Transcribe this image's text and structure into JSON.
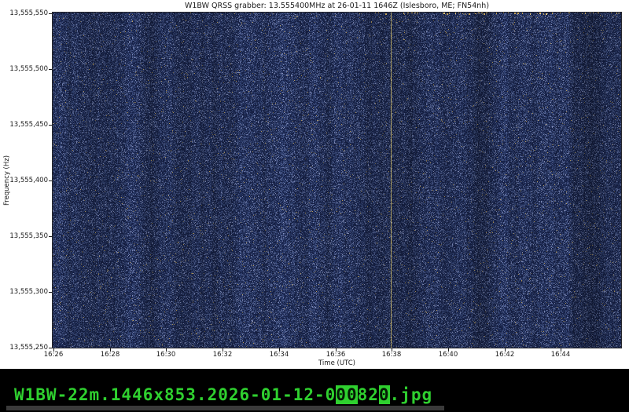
{
  "chart_data": {
    "type": "heatmap",
    "title": "W1BW QRSS grabber: 13.555400MHz at 26-01-11 1646Z (Islesboro, ME; FN54nh)",
    "xlabel": "Time (UTC)",
    "ylabel": "Frequency (Hz)",
    "x_ticks": [
      "16:26",
      "16:28",
      "16:30",
      "16:32",
      "16:34",
      "16:36",
      "16:38",
      "16:40",
      "16:42",
      "16:44"
    ],
    "x_range": [
      "16:26",
      "16:46"
    ],
    "y_ticks": [
      "13,555,550",
      "13,555,500",
      "13,555,450",
      "13,555,400",
      "13,555,350",
      "13,555,300",
      "13,555,250"
    ],
    "y_range_hz": [
      13555250,
      13555550
    ],
    "grid": false,
    "legend": false,
    "description": "QRSS grabber waterfall spectrogram: dark blue RF noise field with faint vertical striation bands, a thin tan vertical line at 16:38 spanning all frequencies, and intermittent tan signal dots along the top edge near 13,555,550 Hz (mostly after ~16:38).",
    "features": {
      "noise_palette": [
        "#141d3e",
        "#1e2a50",
        "#2b3a63",
        "#3d4a74",
        "#55628c",
        "#707aa0",
        "#6a604a",
        "#a48c54"
      ],
      "vertical_line_time": "16:38",
      "vertical_line_color": "#b3a468",
      "signal_dots_freq_hz": 13555550,
      "signal_dots_start_time": "16:33",
      "signal_dots_dense_after": "16:38",
      "signal_dot_colors": [
        "#c2a258",
        "#e2c476"
      ]
    }
  },
  "terminal": {
    "filename": "W1BW-22m.1446x853.2026-01-12-000820.jpg",
    "text_color": "#2fd02f",
    "filename_segments": [
      {
        "text": "W1BW-22m.1446x853.2026-01-12-0",
        "inverse": false
      },
      {
        "text": "00",
        "inverse": true
      },
      {
        "text": "82",
        "inverse": false
      },
      {
        "text": "0",
        "inverse": true
      },
      {
        "text": ".jpg",
        "inverse": false
      }
    ]
  }
}
